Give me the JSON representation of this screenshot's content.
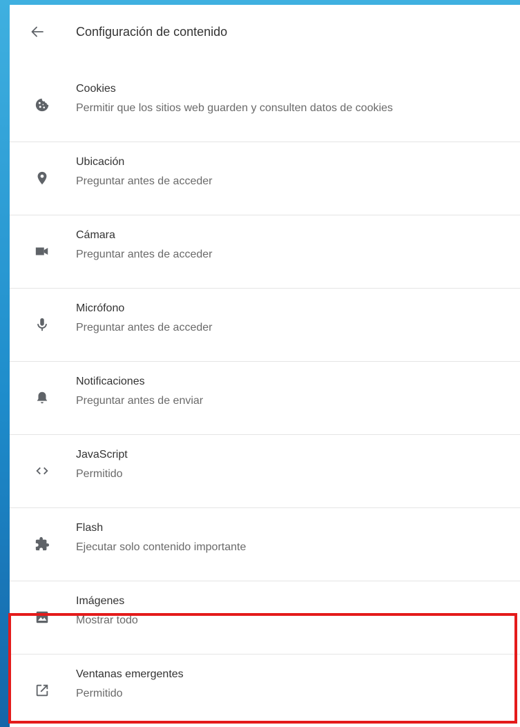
{
  "header": {
    "title": "Configuración de contenido",
    "back_icon": "arrow-back-icon"
  },
  "colors": {
    "highlight": "#e41b1b",
    "icon": "#5f6368",
    "primary_text": "#333333",
    "secondary_text": "#6a6a6a"
  },
  "items": [
    {
      "label": "Cookies",
      "sub": "Permitir que los sitios web guarden y consulten datos de cookies",
      "icon": "cookie-icon"
    },
    {
      "label": "Ubicación",
      "sub": "Preguntar antes de acceder",
      "icon": "location-pin-icon"
    },
    {
      "label": "Cámara",
      "sub": "Preguntar antes de acceder",
      "icon": "camera-icon"
    },
    {
      "label": "Micrófono",
      "sub": "Preguntar antes de acceder",
      "icon": "microphone-icon"
    },
    {
      "label": "Notificaciones",
      "sub": "Preguntar antes de enviar",
      "icon": "bell-icon"
    },
    {
      "label": "JavaScript",
      "sub": "Permitido",
      "icon": "code-icon"
    },
    {
      "label": "Flash",
      "sub": "Ejecutar solo contenido importante",
      "icon": "puzzle-icon"
    },
    {
      "label": "Imágenes",
      "sub": "Mostrar todo",
      "icon": "image-icon"
    },
    {
      "label": "Ventanas emergentes",
      "sub": "Permitido",
      "icon": "open-in-new-icon"
    }
  ]
}
